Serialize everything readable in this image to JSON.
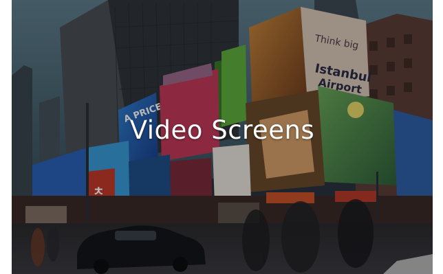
{
  "caption": "Video Screens",
  "colors": {
    "sky": "#4f6f7e",
    "caption_text": "#ffffff",
    "overlay": "rgba(0,0,0,0.28)"
  }
}
